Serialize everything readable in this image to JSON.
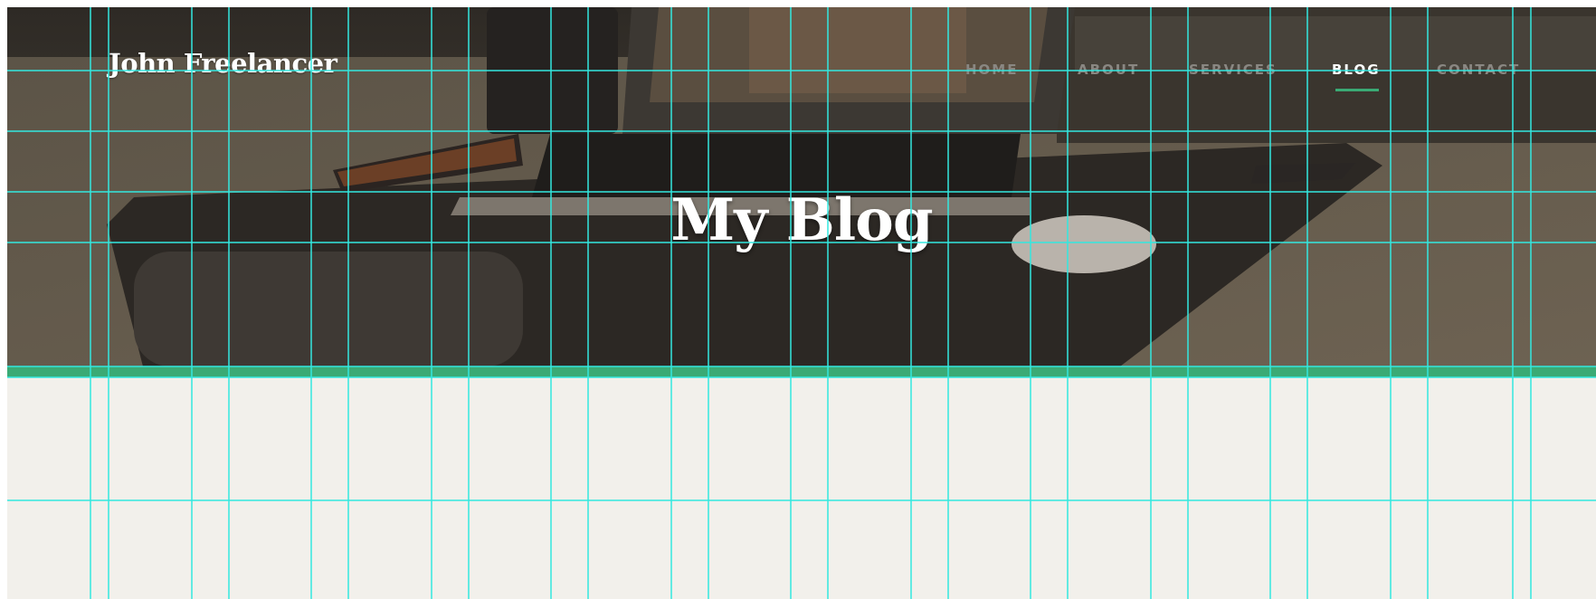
{
  "header": {
    "brand": "John Freelancer"
  },
  "nav": {
    "items": [
      {
        "label": "HOME"
      },
      {
        "label": "ABOUT"
      },
      {
        "label": "SERVICES"
      },
      {
        "label": "BLOG",
        "active": true
      },
      {
        "label": "CONTACT"
      }
    ]
  },
  "hero": {
    "title": "My Blog"
  },
  "colors": {
    "accent": "#3aaa75",
    "page_background": "#f2f0eb",
    "guide_lines": "#33e8e0",
    "nav_inactive": "#8a8782",
    "nav_active": "#ffffff"
  }
}
